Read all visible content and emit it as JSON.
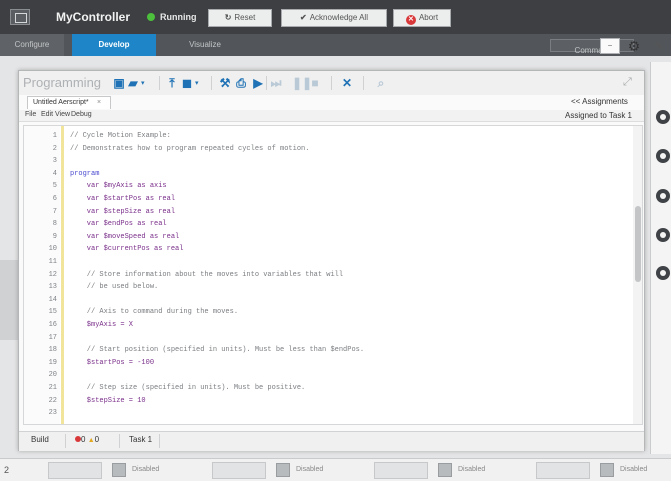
{
  "app": {
    "title": "MyController",
    "status": "Running",
    "reset_label": "Reset",
    "acknowledge_label": "Acknowledge All",
    "abort_label": "Abort",
    "status_color": "#4cc03c",
    "accent_color": "#1e86c8"
  },
  "nav": {
    "tabs": [
      "Configure",
      "Develop",
      "Visualize",
      "Command"
    ],
    "active_tab": "Develop",
    "command_placeholder": "Command"
  },
  "programming": {
    "title": "Programming",
    "file_tab": "Untitled Aerscript*",
    "assignments_link": "<< Assignments",
    "assigned_to": "Assigned to Task 1",
    "menu": [
      "File",
      "Edit",
      "View",
      "Debug"
    ],
    "toolbar_icons": [
      "new-file-icon",
      "open-folder-icon",
      "upload-icon",
      "save-icon",
      "wrench-icon",
      "print-icon",
      "play-icon",
      "step-icon",
      "pause-icon",
      "stop-icon",
      "close-icon"
    ],
    "code_lines": [
      {
        "n": "1",
        "text": "// Cycle Motion Example:",
        "kind": "comment"
      },
      {
        "n": "2",
        "text": "// Demonstrates how to program repeated cycles of motion.",
        "kind": "comment"
      },
      {
        "n": "3",
        "text": "",
        "kind": "plain"
      },
      {
        "n": "4",
        "text": "program",
        "kind": "kw"
      },
      {
        "n": "5",
        "text": "    var $myAxis as axis",
        "kind": "decl"
      },
      {
        "n": "6",
        "text": "    var $startPos as real",
        "kind": "decl"
      },
      {
        "n": "7",
        "text": "    var $stepSize as real",
        "kind": "decl"
      },
      {
        "n": "8",
        "text": "    var $endPos as real",
        "kind": "decl"
      },
      {
        "n": "9",
        "text": "    var $moveSpeed as real",
        "kind": "decl"
      },
      {
        "n": "10",
        "text": "    var $currentPos as real",
        "kind": "decl"
      },
      {
        "n": "11",
        "text": "",
        "kind": "plain"
      },
      {
        "n": "12",
        "text": "    // Store information about the moves into variables that will",
        "kind": "comment"
      },
      {
        "n": "13",
        "text": "    // be used below.",
        "kind": "comment"
      },
      {
        "n": "14",
        "text": "",
        "kind": "plain"
      },
      {
        "n": "15",
        "text": "    // Axis to command during the moves.",
        "kind": "comment"
      },
      {
        "n": "16",
        "text": "    $myAxis = X",
        "kind": "assign"
      },
      {
        "n": "17",
        "text": "",
        "kind": "plain"
      },
      {
        "n": "18",
        "text": "    // Start position (specified in units). Must be less than $endPos.",
        "kind": "comment"
      },
      {
        "n": "19",
        "text": "    $startPos = -100",
        "kind": "assign"
      },
      {
        "n": "20",
        "text": "",
        "kind": "plain"
      },
      {
        "n": "21",
        "text": "    // Step size (specified in units). Must be positive.",
        "kind": "comment"
      },
      {
        "n": "22",
        "text": "    $stepSize = 10",
        "kind": "assign"
      },
      {
        "n": "23",
        "text": "",
        "kind": "plain"
      }
    ],
    "bottom_tabs": {
      "build": "Build",
      "errors": "0",
      "warnings": "0",
      "task": "Task 1"
    }
  },
  "axis_strip": {
    "index": "2",
    "slots": [
      {
        "value": "",
        "label": "Disabled"
      },
      {
        "value": "",
        "label": "Disabled"
      },
      {
        "value": "",
        "label": "Disabled"
      },
      {
        "value": "",
        "label": "Disabled"
      }
    ]
  }
}
